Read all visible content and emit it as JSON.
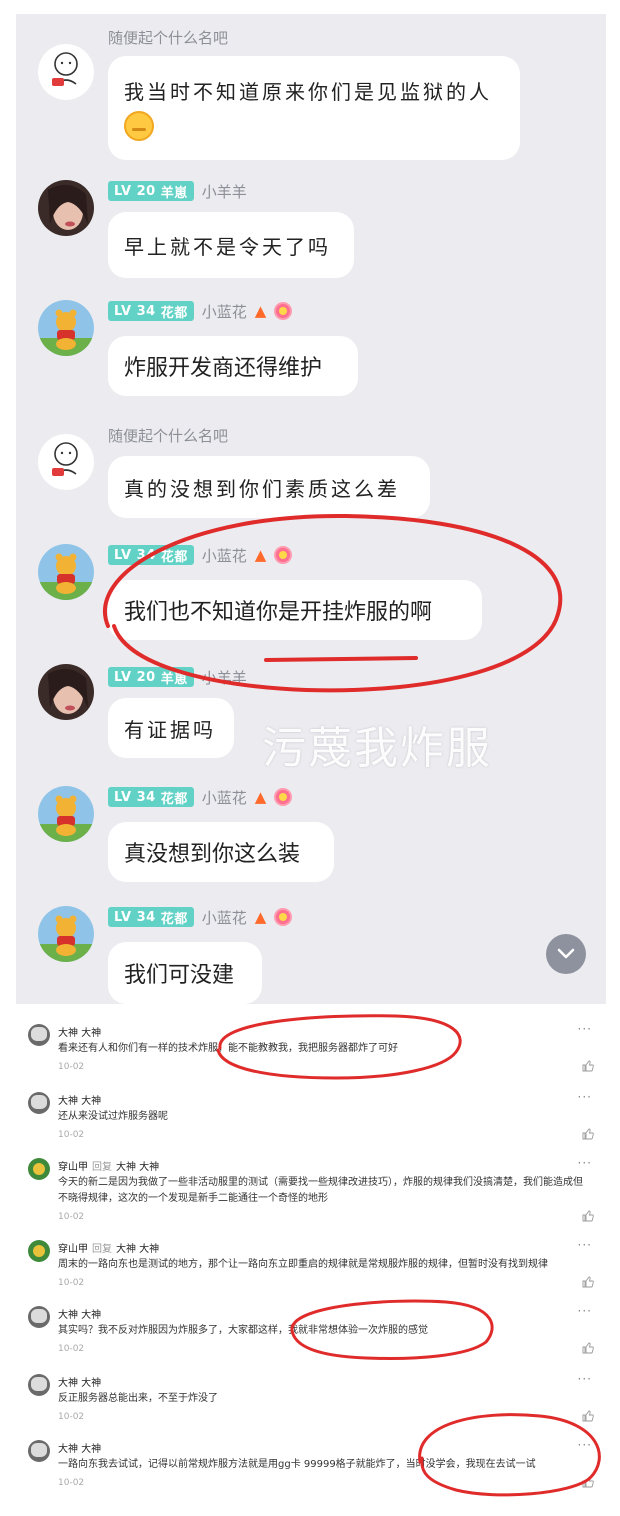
{
  "chat": {
    "messages": [
      {
        "avatar": "meme-character-icon",
        "nick": "随便起个什么名吧",
        "text": "我当时不知道原来你们是见监狱的人",
        "emoji": "awkward-face-emoji"
      },
      {
        "avatar": "girl-photo-avatar",
        "level": "LV 20",
        "tag": "羊崽",
        "nick": "小羊羊",
        "text": "早上就不是令天了吗"
      },
      {
        "avatar": "pooh-bear-avatar",
        "level": "LV 34",
        "tag": "花都",
        "nick": "小蓝花",
        "text": "炸服开发商还得维护"
      },
      {
        "avatar": "meme-character-icon",
        "nick": "随便起个什么名吧",
        "text": "真的没想到你们素质这么差"
      },
      {
        "avatar": "pooh-bear-avatar",
        "level": "LV 34",
        "tag": "花都",
        "nick": "小蓝花",
        "text": "我们也不知道你是开挂炸服的啊"
      },
      {
        "avatar": "girl-photo-avatar",
        "level": "LV 20",
        "tag": "羊崽",
        "nick": "小羊羊",
        "text": "有证据吗"
      },
      {
        "avatar": "pooh-bear-avatar",
        "level": "LV 34",
        "tag": "花都",
        "nick": "小蓝花",
        "text": "真没想到你这么装"
      },
      {
        "avatar": "pooh-bear-avatar",
        "level": "LV 34",
        "tag": "花都",
        "nick": "小蓝花",
        "text": "我们可没建"
      }
    ],
    "watermark": "污蔑我炸服",
    "accent": "#63d2c6",
    "annotation_color": "#e02b2b"
  },
  "comments": [
    {
      "user": "大神 大神",
      "text": "看来还有人和你们有一样的技术炸服，能不能教教我，我把服务器都炸了可好",
      "date": "10-02",
      "more": "···"
    },
    {
      "user": "大神 大神",
      "text": "还从来没试过炸服务器呢",
      "date": "10-02",
      "more": "···"
    },
    {
      "user": "穿山甲",
      "reply": "回复",
      "reply_to": "大神 大神",
      "text": "今天的新二是因为我做了一些非活动服里的测试（需要找一些规律改进技巧），炸服的规律我们没搞清楚，我们能造成但不晓得规律，这次的一个发现是新手二能通往一个奇怪的地形",
      "date": "10-02",
      "more": "···"
    },
    {
      "user": "穿山甲",
      "reply": "回复",
      "reply_to": "大神 大神",
      "text": "周末的一路向东也是测试的地方，那个让一路向东立即重启的规律就是常规服炸服的规律，但暂时没有找到规律",
      "date": "10-02",
      "more": "···"
    },
    {
      "user": "大神 大神",
      "text": "其实吗？我不反对炸服因为炸服多了，大家都这样，我就非常想体验一次炸服的感觉",
      "date": "10-02",
      "more": "···"
    },
    {
      "user": "大神 大神",
      "text": "反正服务器总能出来，不至于炸没了",
      "date": "10-02",
      "more": "···"
    },
    {
      "user": "大神 大神",
      "text": "一路向东我去试试，记得以前常规炸服方法就是用gg卡 99999格子就能炸了，当时没学会，我现在去试一试",
      "date": "10-02",
      "more": "···"
    }
  ]
}
